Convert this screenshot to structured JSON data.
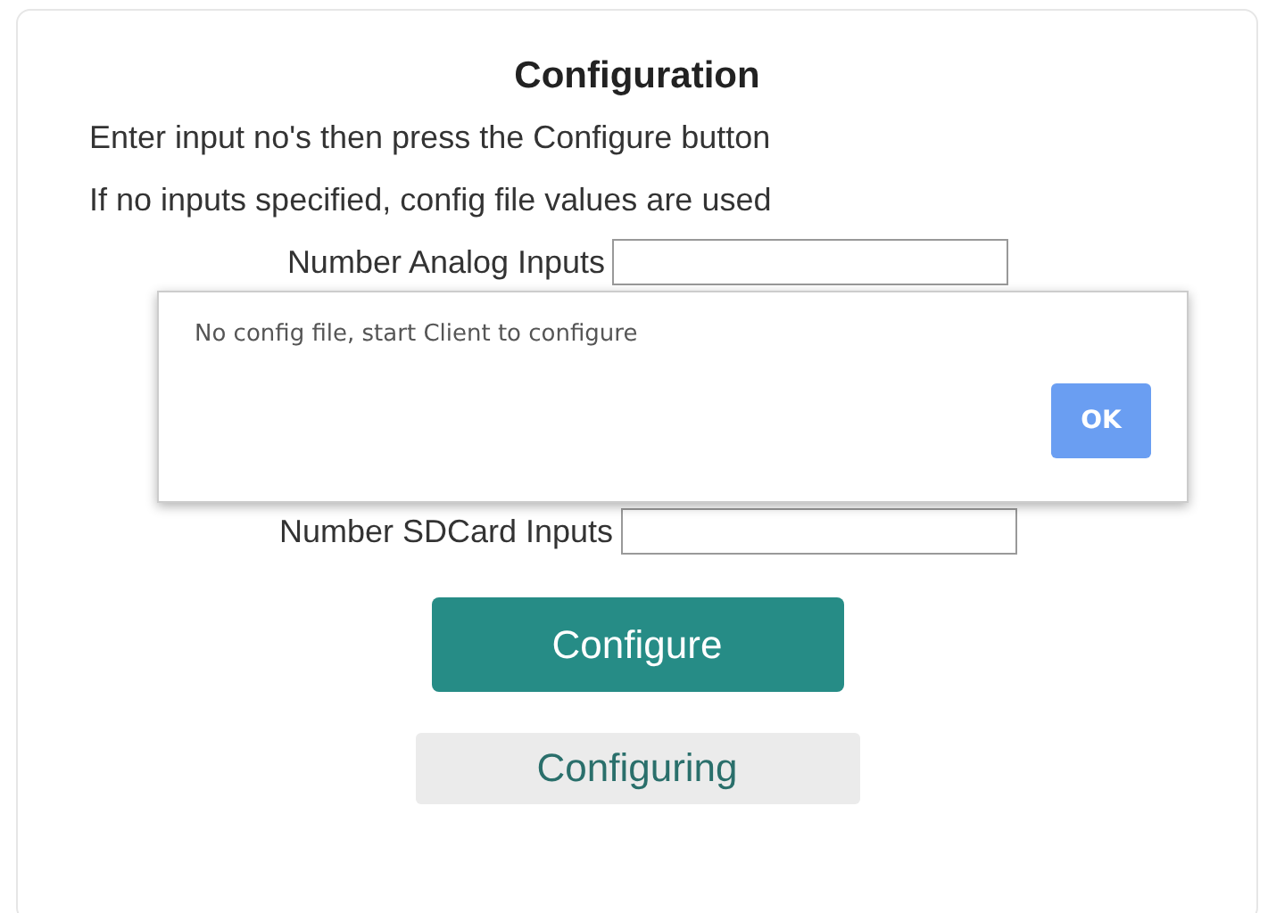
{
  "title": "Configuration",
  "instructions": [
    "Enter input no's then press the Configure button",
    "If no inputs specified, config file values are used"
  ],
  "fields": [
    {
      "label": "Number Analog Inputs"
    },
    {
      "label": "Number SDCard Inputs"
    }
  ],
  "configure_button": "Configure",
  "status": "Configuring",
  "dialog": {
    "message": "No config file, start Client to configure",
    "button": "OK"
  }
}
